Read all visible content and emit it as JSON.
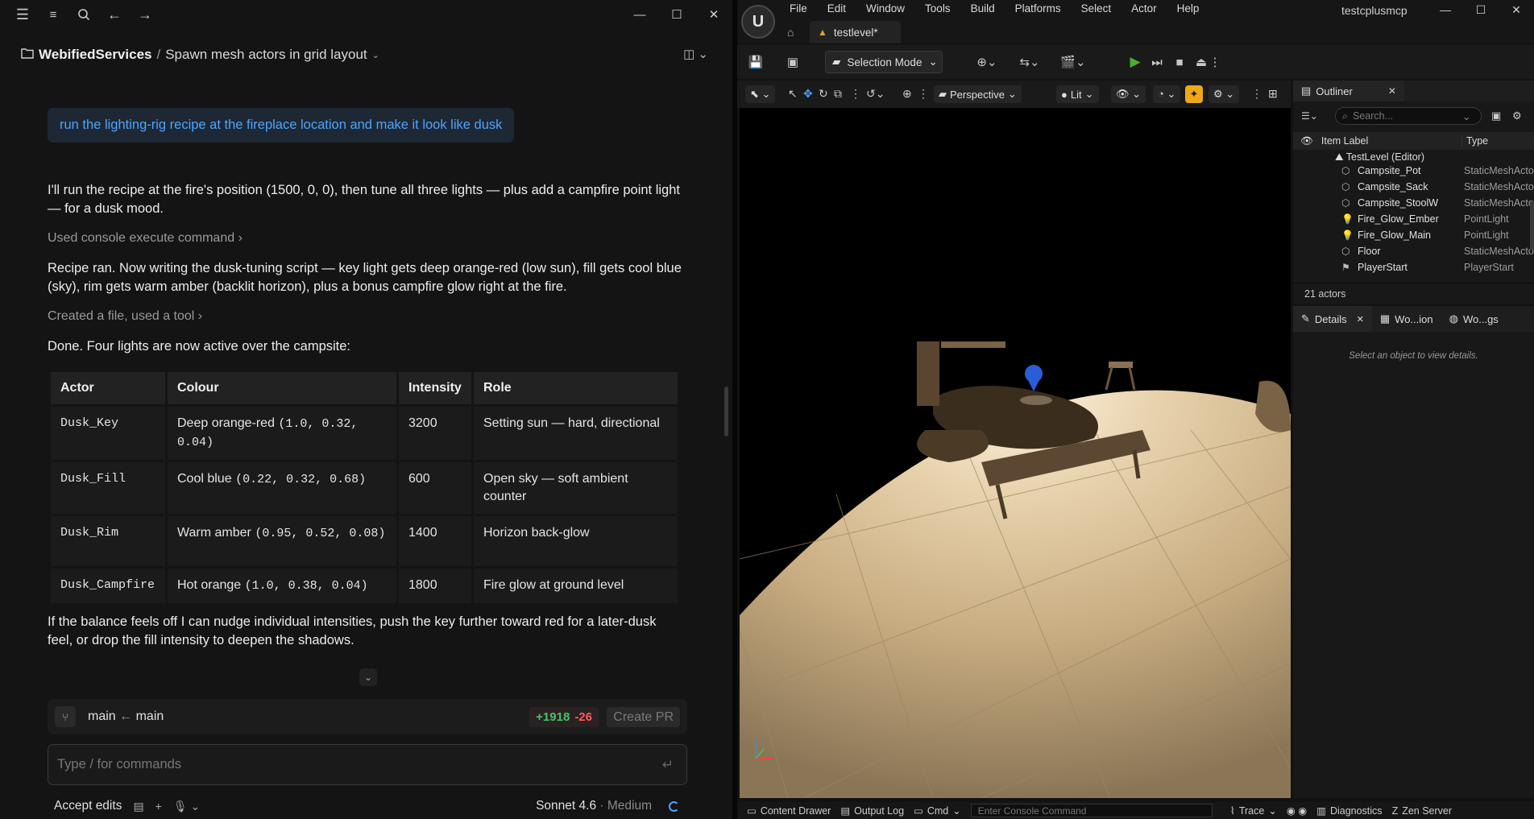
{
  "claude": {
    "breadcrumb": {
      "project": "WebifiedServices",
      "separator": "/",
      "task": "Spawn mesh actors in grid layout"
    },
    "user_message": "run the lighting-rig recipe at the fireplace location and make it look like dusk",
    "para1": "I'll run the recipe at the fire's position (1500, 0, 0), then tune all three lights — plus add a campfire point light — for a dusk mood.",
    "tool1": "Used console execute command",
    "para2": "Recipe ran. Now writing the dusk-tuning script — key light gets deep orange-red (low sun), fill gets cool blue (sky), rim gets warm amber (backlit horizon), plus a bonus campfire glow right at the fire.",
    "tool2": "Created a file, used a tool",
    "para3": "Done. Four lights are now active over the campsite:",
    "table": {
      "headers": [
        "Actor",
        "Colour",
        "Intensity",
        "Role"
      ],
      "rows": [
        {
          "actor": "Dusk_Key",
          "colour_name": "Deep orange-red",
          "colour_value": "(1.0, 0.32, 0.04)",
          "intensity": "3200",
          "role": "Setting sun — hard, directional"
        },
        {
          "actor": "Dusk_Fill",
          "colour_name": "Cool blue",
          "colour_value": "(0.22, 0.32, 0.68)",
          "intensity": "600",
          "role": "Open sky — soft ambient counter"
        },
        {
          "actor": "Dusk_Rim",
          "colour_name": "Warm amber",
          "colour_value": "(0.95, 0.52, 0.08)",
          "intensity": "1400",
          "role": "Horizon back-glow"
        },
        {
          "actor": "Dusk_Campfire",
          "colour_name": "Hot orange",
          "colour_value": "(1.0, 0.38, 0.04)",
          "intensity": "1800",
          "role": "Fire glow at ground level"
        }
      ]
    },
    "para4": "If the balance feels off I can nudge individual intensities, push the key further toward red for a later-dusk feel, or drop the fill intensity to deepen the shadows.",
    "branch": {
      "from": "main",
      "arrow": "←",
      "to": "main",
      "added": "+1918",
      "removed": "-26",
      "create_pr": "Create PR"
    },
    "input_placeholder": "Type / for commands",
    "footer": {
      "accept_edits": "Accept edits",
      "model": "Sonnet 4.6",
      "effort": "· Medium"
    },
    "accent": "#4ea3ff"
  },
  "unreal": {
    "menu": [
      "File",
      "Edit",
      "Window",
      "Tools",
      "Build",
      "Platforms",
      "Select",
      "Actor",
      "Help"
    ],
    "project_title": "testcplusmcp",
    "level_tab": "testlevel*",
    "selection_mode": "Selection Mode",
    "viewport": {
      "perspective": "Perspective",
      "lit": "Lit"
    },
    "outliner": {
      "title": "Outliner",
      "search_placeholder": "Search...",
      "col_label": "Item Label",
      "col_type": "Type",
      "level": "TestLevel (Editor)",
      "rows": [
        {
          "name": "Campsite_Pot",
          "type": "StaticMeshActor",
          "icon": "mesh-icon"
        },
        {
          "name": "Campsite_Sack",
          "type": "StaticMeshActor",
          "icon": "mesh-icon"
        },
        {
          "name": "Campsite_StoolW",
          "type": "StaticMeshActor",
          "icon": "mesh-icon"
        },
        {
          "name": "Fire_Glow_Ember",
          "type": "PointLight",
          "icon": "bulb-icon"
        },
        {
          "name": "Fire_Glow_Main",
          "type": "PointLight",
          "icon": "bulb-icon"
        },
        {
          "name": "Floor",
          "type": "StaticMeshActor",
          "icon": "mesh-icon"
        },
        {
          "name": "PlayerStart",
          "type": "PlayerStart",
          "icon": "flag-icon"
        }
      ],
      "count": "21 actors"
    },
    "details": {
      "tabs": [
        "Details",
        "Wo...ion",
        "Wo...gs"
      ],
      "hint": "Select an object to view details."
    },
    "statusbar": {
      "content_drawer": "Content Drawer",
      "output_log": "Output Log",
      "cmd": "Cmd",
      "console_placeholder": "Enter Console Command",
      "trace": "Trace",
      "diagnostics": "Diagnostics",
      "zen": "Zen Server"
    }
  }
}
